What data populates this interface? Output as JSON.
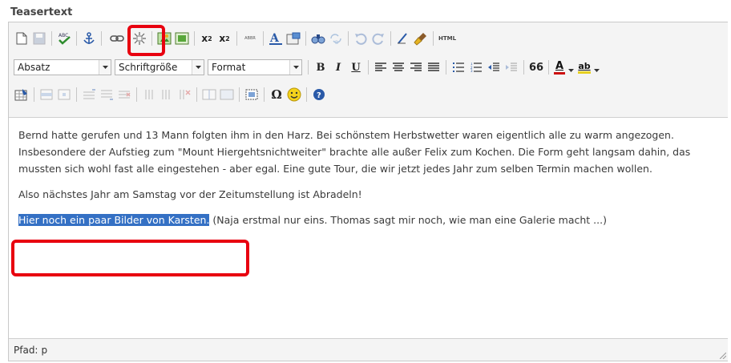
{
  "field_label": "Teasertext",
  "toolbar": {
    "block_format": "Absatz",
    "font_size": "Schriftgröße",
    "format": "Format",
    "bold": "B",
    "italic": "I",
    "underline": "U",
    "abbr": "ABBR",
    "html": "HTML",
    "quote": "66",
    "font_color_letter": "A",
    "highlight_letter": "ab"
  },
  "content": {
    "paragraphs": [
      "Bernd hatte gerufen und 13 Mann folgten ihm in den Harz. Bei schönstem Herbstwetter waren eigentlich alle zu warm angezogen. Insbesondere der Aufstieg zum \"Mount Hiergehtsnichtweiter\" brachte alle außer Felix zum Kochen. Die Form geht langsam dahin, das mussten sich wohl fast alle eingestehen - aber egal. Eine gute Tour, die wir jetzt jedes Jahr zum selben Termin machen wollen.",
      "Also nächstes Jahr am Samstag vor der Zeitumstellung ist Abradeln!"
    ],
    "selected_text": "Hier noch ein paar Bilder von Karsten",
    "selected_after": ".",
    "trailing_text": " (Naja erstmal nur eins. Thomas sagt mir noch, wie man eine Galerie macht ...)"
  },
  "status": {
    "path_label": "Pfad:",
    "path_value": "p"
  },
  "colors": {
    "highlight": "#e8000f",
    "selection": "#3470c4"
  }
}
